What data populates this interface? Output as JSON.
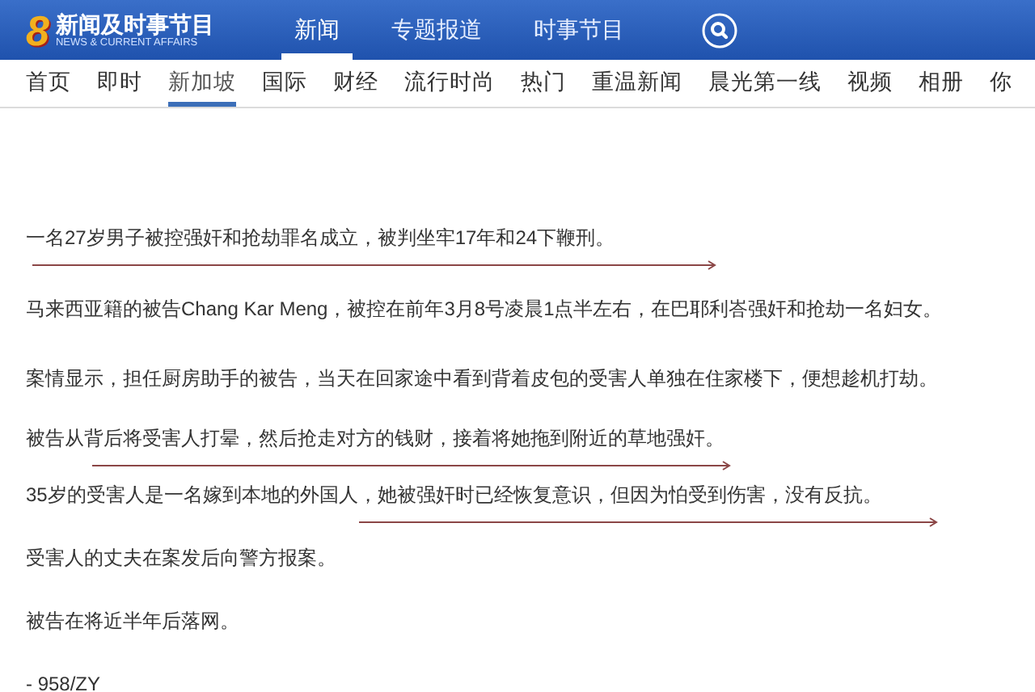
{
  "header": {
    "logo": "8",
    "title": "新闻及时事节目",
    "subtitle": "NEWS & CURRENT AFFAIRS",
    "tabs": [
      {
        "label": "新闻",
        "selected": true
      },
      {
        "label": "专题报道",
        "selected": false
      },
      {
        "label": "时事节目",
        "selected": false
      }
    ]
  },
  "nav": [
    {
      "label": "首页",
      "selected": false
    },
    {
      "label": "即时",
      "selected": false
    },
    {
      "label": "新加坡",
      "selected": true
    },
    {
      "label": "国际",
      "selected": false
    },
    {
      "label": "财经",
      "selected": false
    },
    {
      "label": "流行时尚",
      "selected": false
    },
    {
      "label": "热门",
      "selected": false
    },
    {
      "label": "重温新闻",
      "selected": false
    },
    {
      "label": "晨光第一线",
      "selected": false
    },
    {
      "label": "视频",
      "selected": false
    },
    {
      "label": "相册",
      "selected": false
    },
    {
      "label": "你",
      "selected": false
    }
  ],
  "article": [
    {
      "text": "一名27岁男子被控强奸和抢劫罪名成立，被判坐牢17年和24下鞭刑。",
      "marked": true
    },
    {
      "text": "马来西亚籍的被告Chang Kar Meng，被控在前年3月8号凌晨1点半左右，在巴耶利峇强奸和抢劫一名妇女。",
      "marked": false
    },
    {
      "text": "案情显示，担任厨房助手的被告，当天在回家途中看到背着皮包的受害人单独在住家楼下，便想趁机打劫。",
      "marked": false
    },
    {
      "text": "被告从背后将受害人打晕，然后抢走对方的钱财，接着将她拖到附近的草地强奸。",
      "marked": true
    },
    {
      "text": "35岁的受害人是一名嫁到本地的外国人，她被强奸时已经恢复意识，但因为怕受到伤害，没有反抗。",
      "marked": true
    },
    {
      "text": "受害人的丈夫在案发后向警方报案。",
      "marked": false
    },
    {
      "text": "被告在将近半年后落网。",
      "marked": false
    },
    {
      "text": "- 958/ZY",
      "marked": false
    }
  ]
}
